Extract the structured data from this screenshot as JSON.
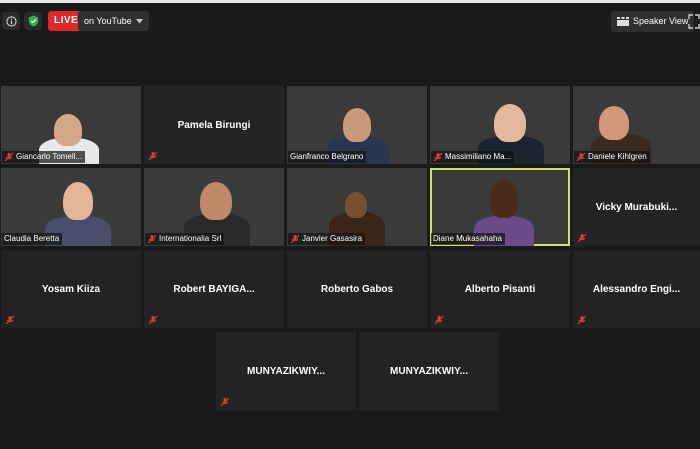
{
  "toolbar": {
    "info_icon": "info-icon",
    "shield_icon": "shield-check-icon",
    "live_label": "LIVE",
    "stream_label": "on YouTube",
    "view_label": "Speaker View",
    "colors": {
      "live": "#e02828",
      "shield": "#2db24a",
      "active_border": "#d4e063",
      "muted_mic": "#e03a3a"
    }
  },
  "participants": [
    {
      "name": "Giancarlo Tomell...",
      "video": true,
      "muted": true
    },
    {
      "name": "Pamela Birungi",
      "video": false,
      "muted": true
    },
    {
      "name": "Gianfranco Belgrano",
      "video": true,
      "muted": false
    },
    {
      "name": "Massimiliano Ma...",
      "video": true,
      "muted": true
    },
    {
      "name": "Daniele Kihlgren",
      "video": true,
      "muted": true
    },
    {
      "name": "Claudia Beretta",
      "video": true,
      "muted": false
    },
    {
      "name": "Internationalia Srl",
      "video": true,
      "muted": true
    },
    {
      "name": "Janvier Gasasira",
      "video": true,
      "muted": true
    },
    {
      "name": "Diane Mukasahaha",
      "video": true,
      "muted": false,
      "active_speaker": true
    },
    {
      "name": "Vicky  Murabuki...",
      "video": false,
      "muted": true
    },
    {
      "name": "Yosam Kiiza",
      "video": false,
      "muted": true
    },
    {
      "name": "Robert  BAYIGA...",
      "video": false,
      "muted": true
    },
    {
      "name": "Roberto Gabos",
      "video": false,
      "muted": false
    },
    {
      "name": "Alberto Pisanti",
      "video": false,
      "muted": true
    },
    {
      "name": "Alessandro  Engi...",
      "video": false,
      "muted": true
    },
    {
      "name": "MUNYAZIKWIY...",
      "video": false,
      "muted": true
    },
    {
      "name": "MUNYAZIKWIY...",
      "video": false,
      "muted": false
    }
  ]
}
